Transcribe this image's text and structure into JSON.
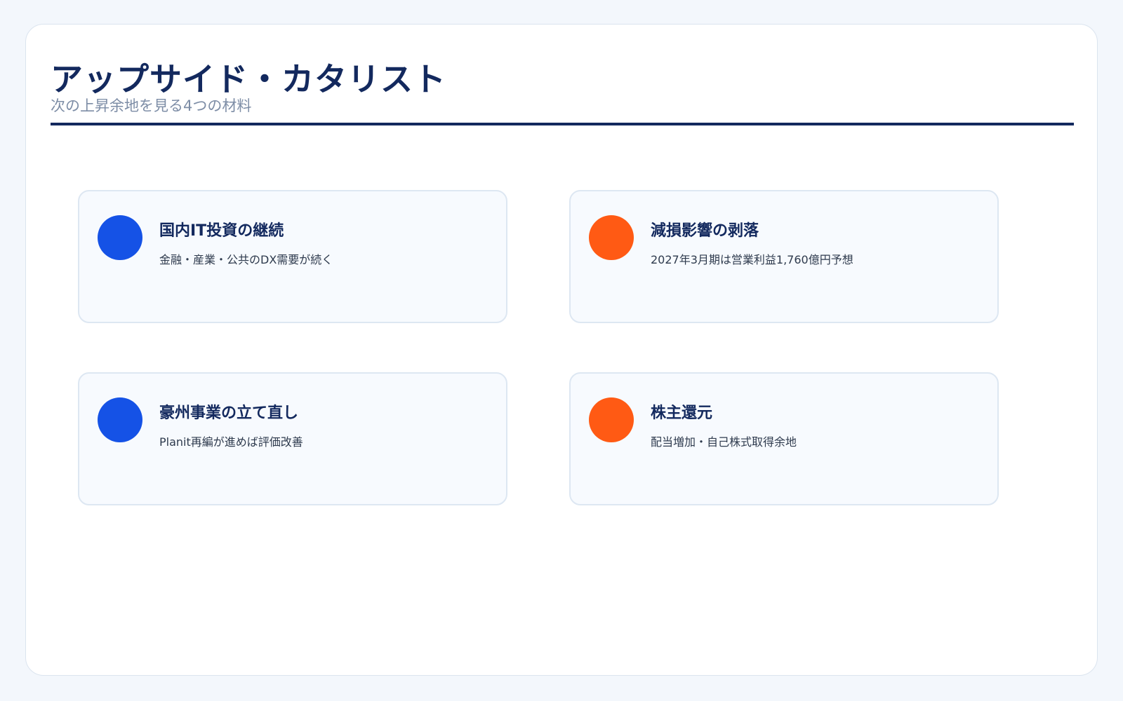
{
  "header": {
    "title": "アップサイド・カタリスト",
    "subtitle": "次の上昇余地を見る4つの材料"
  },
  "colors": {
    "navy": "#13295e",
    "blue_accent": "#1552e6",
    "orange_accent": "#ff5a14"
  },
  "cards": [
    {
      "title": "国内IT投資の継続",
      "description": "金融・産業・公共のDX需要が続く",
      "accent": "#1552e6"
    },
    {
      "title": "減損影響の剥落",
      "description": "2027年3月期は営業利益1,760億円予想",
      "accent": "#ff5a14"
    },
    {
      "title": "豪州事業の立て直し",
      "description": "Planit再編が進めば評価改善",
      "accent": "#1552e6"
    },
    {
      "title": "株主還元",
      "description": "配当増加・自己株式取得余地",
      "accent": "#ff5a14"
    }
  ]
}
